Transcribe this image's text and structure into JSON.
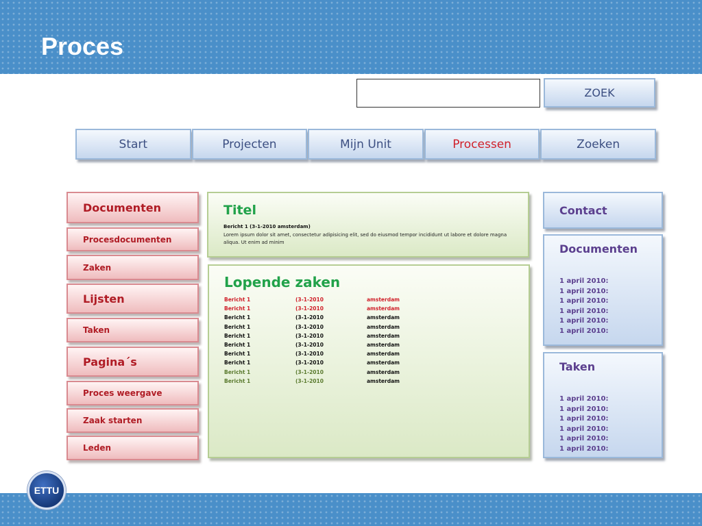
{
  "slide": {
    "title": "Proces"
  },
  "search": {
    "placeholder": "",
    "button_label": "ZOEK"
  },
  "nav": {
    "items": [
      {
        "label": "Start"
      },
      {
        "label": "Projecten"
      },
      {
        "label": "Mijn Unit"
      },
      {
        "label": "Processen",
        "active": true
      },
      {
        "label": "Zoeken"
      }
    ]
  },
  "sidebar": {
    "items": [
      {
        "label": "Documenten"
      },
      {
        "label": "Procesdocumenten"
      },
      {
        "label": "Zaken"
      },
      {
        "label": "Lijsten"
      },
      {
        "label": "Taken"
      },
      {
        "label": "Pagina´s"
      },
      {
        "label": "Proces weergave"
      },
      {
        "label": "Zaak starten"
      },
      {
        "label": "Leden"
      }
    ]
  },
  "titel_panel": {
    "heading": "Titel",
    "message_header": "Bericht 1 (3-1-2010 amsterdam)",
    "message_body": "Lorem ipsum dolor sit amet, consectetur adipisicing elit, sed do eiusmod tempor incididunt ut labore et dolore magna aliqua. Ut enim ad minim"
  },
  "lopende_zaken": {
    "heading": "Lopende zaken",
    "rows": [
      {
        "subject": "Bericht 1",
        "date": "(3-1-2010",
        "place": "amsterdam"
      },
      {
        "subject": "Bericht 1",
        "date": "(3-1-2010",
        "place": "amsterdam"
      },
      {
        "subject": "Bericht 1",
        "date": "(3-1-2010",
        "place": "amsterdam"
      },
      {
        "subject": "Bericht 1",
        "date": "(3-1-2010",
        "place": "amsterdam"
      },
      {
        "subject": "Bericht 1",
        "date": "(3-1-2010",
        "place": "amsterdam"
      },
      {
        "subject": "Bericht 1",
        "date": "(3-1-2010",
        "place": "amsterdam"
      },
      {
        "subject": "Bericht 1",
        "date": "(3-1-2010",
        "place": "amsterdam"
      },
      {
        "subject": "Bericht 1",
        "date": "(3-1-2010",
        "place": "amsterdam"
      },
      {
        "subject": "Bericht 1",
        "date": "(3-1-2010",
        "place": "amsterdam"
      },
      {
        "subject": "Bericht 1",
        "date": "(3-1-2010",
        "place": "amsterdam"
      }
    ]
  },
  "right": {
    "contact_label": "Contact",
    "documenten": {
      "heading": "Documenten",
      "dates": [
        "1 april 2010:",
        "1 april 2010:",
        "1 april 2010:",
        "1 april 2010:",
        "1 april 2010:",
        "1 april 2010:"
      ]
    },
    "taken": {
      "heading": "Taken",
      "dates": [
        "1 april 2010:",
        "1 april 2010:",
        "1 april 2010:",
        "1 april 2010:",
        "1 april 2010:",
        "1 april 2010:"
      ]
    }
  },
  "logo": {
    "text": "ETTU"
  },
  "colors": {
    "band_blue": "#4a8fc9",
    "nav_text": "#3c4f82",
    "active_red": "#d0202a",
    "sidebar_red": "#b01c25",
    "green_heading": "#21a24a",
    "purple_text": "#5b3f8e",
    "row_red": "#d0202a",
    "row_black": "#111111",
    "row_green": "#5a7a2e"
  }
}
